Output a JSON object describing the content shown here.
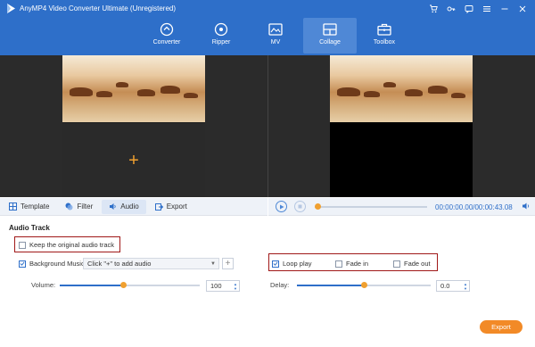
{
  "app": {
    "title": "AnyMP4 Video Converter Ultimate (Unregistered)"
  },
  "window_controls": [
    "cart-icon",
    "key-icon",
    "chat-icon",
    "menu-icon",
    "minimize-icon",
    "close-icon"
  ],
  "nav": {
    "items": [
      {
        "label": "Converter",
        "icon": "converter-icon"
      },
      {
        "label": "Ripper",
        "icon": "ripper-icon"
      },
      {
        "label": "MV",
        "icon": "mv-icon"
      },
      {
        "label": "Collage",
        "icon": "collage-icon",
        "active": true
      },
      {
        "label": "Toolbox",
        "icon": "toolbox-icon"
      }
    ]
  },
  "tabs": [
    {
      "label": "Template",
      "icon": "template-icon"
    },
    {
      "label": "Filter",
      "icon": "filter-icon"
    },
    {
      "label": "Audio",
      "icon": "audio-icon",
      "active": true
    },
    {
      "label": "Export",
      "icon": "export-icon"
    }
  ],
  "player": {
    "time": "00:00:00.00/00:00:43.08",
    "progress": 0.0
  },
  "audio": {
    "section_title": "Audio Track",
    "keep_original_label": "Keep the original audio track",
    "keep_original_checked": false,
    "bg_music_label": "Background Music",
    "bg_music_checked": true,
    "bg_music_value": "Click \"+\" to add audio",
    "add_label": "+",
    "volume_label": "Volume:",
    "volume_value": "100",
    "volume_level": 0.45,
    "loop_play_label": "Loop play",
    "loop_play_checked": true,
    "fade_in_label": "Fade in",
    "fade_in_checked": false,
    "fade_out_label": "Fade out",
    "fade_out_checked": false,
    "delay_label": "Delay:",
    "delay_value": "0.0",
    "delay_level": 0.5
  },
  "export_label": "Export",
  "colors": {
    "brand": "#2e6fc9",
    "accent": "#f28a27",
    "highlight_box": "#a01818"
  }
}
